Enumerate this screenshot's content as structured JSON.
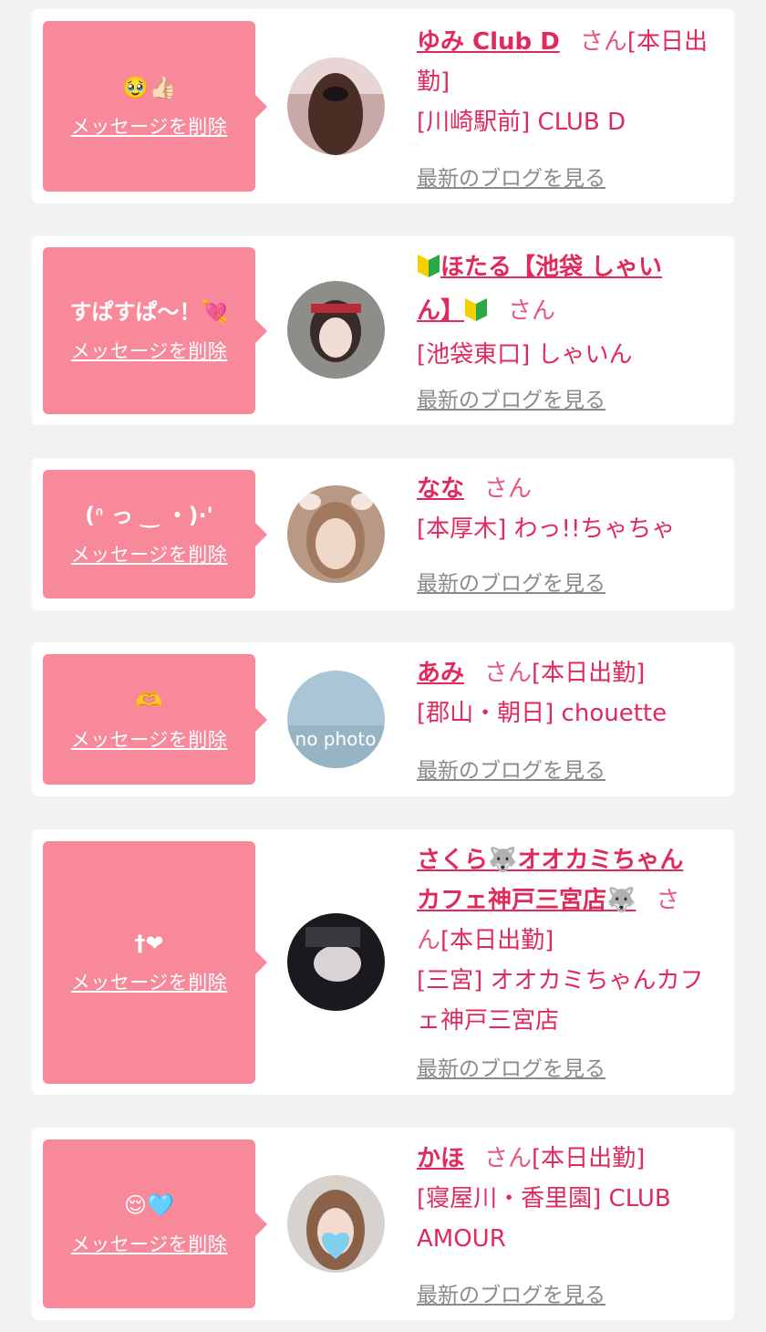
{
  "colors": {
    "page_bg": "#f2f2f2",
    "card_bg": "#ffffff",
    "bubble_bg": "#f7899b",
    "accent": "#e02a5c",
    "blog_link": "#8a8a8a"
  },
  "cards": [
    {
      "message": "🥹👍🏻",
      "delete_label": "メッセージを削除",
      "name": "ゆみ Club D",
      "san": "さん",
      "status": "[本日出勤]",
      "shop": "[川崎駅前] CLUB D",
      "blog_label": "最新のブログを見る"
    },
    {
      "message": "すぱすぱ〜！💘",
      "delete_label": "メッセージを削除",
      "name_line1": "ほたる【池袋 しゃい",
      "name_line2": "ん】",
      "san": "さん",
      "status": "",
      "shop": "[池袋東口] しゃいん",
      "blog_label": "最新のブログを見る"
    },
    {
      "message": "(ᐢ っ ‿ ・)·'",
      "delete_label": "メッセージを削除",
      "name": "なな",
      "san": "さん",
      "status": "",
      "shop": "[本厚木] わっ!!ちゃちゃ",
      "blog_label": "最新のブログを見る"
    },
    {
      "message": "🫶",
      "delete_label": "メッセージを削除",
      "name": "あみ",
      "san": "さん",
      "status": "[本日出勤]",
      "shop": "[郡山・朝日] chouette",
      "blog_label": "最新のブログを見る",
      "avatar_text": "no photo"
    },
    {
      "message": "†❤",
      "delete_label": "メッセージを削除",
      "name_line1": "さくら🐺オオカミちゃん",
      "name_line2": "カフェ神戸三宮店🐺",
      "san_line1": "さ",
      "san_line2": "ん",
      "status": "[本日出勤]",
      "shop_line1": "[三宮] オオカミちゃんカフ",
      "shop_line2": "ェ神戸三宮店",
      "blog_label": "最新のブログを見る"
    },
    {
      "message": "😌🩵",
      "delete_label": "メッセージを削除",
      "name": "かほ",
      "san": "さん",
      "status": "[本日出勤]",
      "shop_line1": "[寝屋川・香里園] CLUB",
      "shop_line2": "AMOUR",
      "blog_label": "最新のブログを見る"
    }
  ]
}
